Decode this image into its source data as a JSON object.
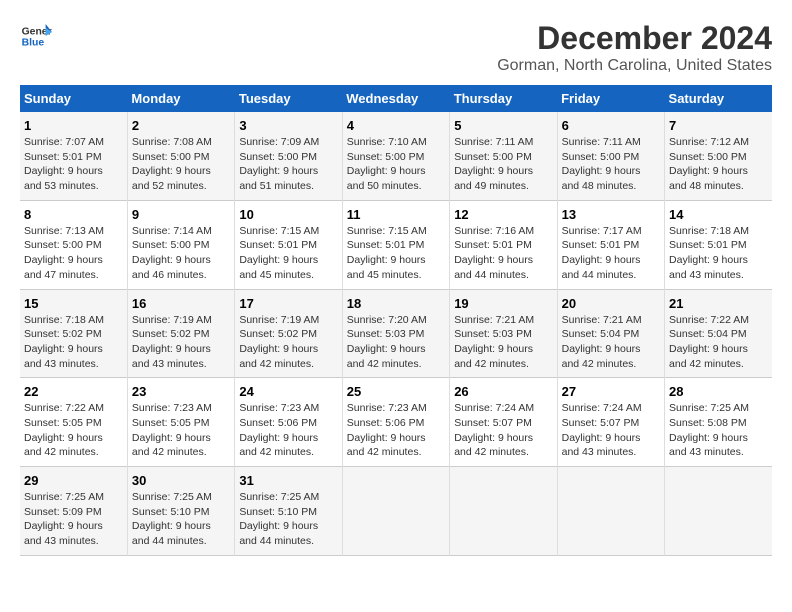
{
  "logo": {
    "line1": "General",
    "line2": "Blue"
  },
  "title": "December 2024",
  "subtitle": "Gorman, North Carolina, United States",
  "header_color": "#1565c0",
  "columns": [
    "Sunday",
    "Monday",
    "Tuesday",
    "Wednesday",
    "Thursday",
    "Friday",
    "Saturday"
  ],
  "weeks": [
    [
      {
        "day": "1",
        "info": "Sunrise: 7:07 AM\nSunset: 5:01 PM\nDaylight: 9 hours\nand 53 minutes."
      },
      {
        "day": "2",
        "info": "Sunrise: 7:08 AM\nSunset: 5:00 PM\nDaylight: 9 hours\nand 52 minutes."
      },
      {
        "day": "3",
        "info": "Sunrise: 7:09 AM\nSunset: 5:00 PM\nDaylight: 9 hours\nand 51 minutes."
      },
      {
        "day": "4",
        "info": "Sunrise: 7:10 AM\nSunset: 5:00 PM\nDaylight: 9 hours\nand 50 minutes."
      },
      {
        "day": "5",
        "info": "Sunrise: 7:11 AM\nSunset: 5:00 PM\nDaylight: 9 hours\nand 49 minutes."
      },
      {
        "day": "6",
        "info": "Sunrise: 7:11 AM\nSunset: 5:00 PM\nDaylight: 9 hours\nand 48 minutes."
      },
      {
        "day": "7",
        "info": "Sunrise: 7:12 AM\nSunset: 5:00 PM\nDaylight: 9 hours\nand 48 minutes."
      }
    ],
    [
      {
        "day": "8",
        "info": "Sunrise: 7:13 AM\nSunset: 5:00 PM\nDaylight: 9 hours\nand 47 minutes."
      },
      {
        "day": "9",
        "info": "Sunrise: 7:14 AM\nSunset: 5:00 PM\nDaylight: 9 hours\nand 46 minutes."
      },
      {
        "day": "10",
        "info": "Sunrise: 7:15 AM\nSunset: 5:01 PM\nDaylight: 9 hours\nand 45 minutes."
      },
      {
        "day": "11",
        "info": "Sunrise: 7:15 AM\nSunset: 5:01 PM\nDaylight: 9 hours\nand 45 minutes."
      },
      {
        "day": "12",
        "info": "Sunrise: 7:16 AM\nSunset: 5:01 PM\nDaylight: 9 hours\nand 44 minutes."
      },
      {
        "day": "13",
        "info": "Sunrise: 7:17 AM\nSunset: 5:01 PM\nDaylight: 9 hours\nand 44 minutes."
      },
      {
        "day": "14",
        "info": "Sunrise: 7:18 AM\nSunset: 5:01 PM\nDaylight: 9 hours\nand 43 minutes."
      }
    ],
    [
      {
        "day": "15",
        "info": "Sunrise: 7:18 AM\nSunset: 5:02 PM\nDaylight: 9 hours\nand 43 minutes."
      },
      {
        "day": "16",
        "info": "Sunrise: 7:19 AM\nSunset: 5:02 PM\nDaylight: 9 hours\nand 43 minutes."
      },
      {
        "day": "17",
        "info": "Sunrise: 7:19 AM\nSunset: 5:02 PM\nDaylight: 9 hours\nand 42 minutes."
      },
      {
        "day": "18",
        "info": "Sunrise: 7:20 AM\nSunset: 5:03 PM\nDaylight: 9 hours\nand 42 minutes."
      },
      {
        "day": "19",
        "info": "Sunrise: 7:21 AM\nSunset: 5:03 PM\nDaylight: 9 hours\nand 42 minutes."
      },
      {
        "day": "20",
        "info": "Sunrise: 7:21 AM\nSunset: 5:04 PM\nDaylight: 9 hours\nand 42 minutes."
      },
      {
        "day": "21",
        "info": "Sunrise: 7:22 AM\nSunset: 5:04 PM\nDaylight: 9 hours\nand 42 minutes."
      }
    ],
    [
      {
        "day": "22",
        "info": "Sunrise: 7:22 AM\nSunset: 5:05 PM\nDaylight: 9 hours\nand 42 minutes."
      },
      {
        "day": "23",
        "info": "Sunrise: 7:23 AM\nSunset: 5:05 PM\nDaylight: 9 hours\nand 42 minutes."
      },
      {
        "day": "24",
        "info": "Sunrise: 7:23 AM\nSunset: 5:06 PM\nDaylight: 9 hours\nand 42 minutes."
      },
      {
        "day": "25",
        "info": "Sunrise: 7:23 AM\nSunset: 5:06 PM\nDaylight: 9 hours\nand 42 minutes."
      },
      {
        "day": "26",
        "info": "Sunrise: 7:24 AM\nSunset: 5:07 PM\nDaylight: 9 hours\nand 42 minutes."
      },
      {
        "day": "27",
        "info": "Sunrise: 7:24 AM\nSunset: 5:07 PM\nDaylight: 9 hours\nand 43 minutes."
      },
      {
        "day": "28",
        "info": "Sunrise: 7:25 AM\nSunset: 5:08 PM\nDaylight: 9 hours\nand 43 minutes."
      }
    ],
    [
      {
        "day": "29",
        "info": "Sunrise: 7:25 AM\nSunset: 5:09 PM\nDaylight: 9 hours\nand 43 minutes."
      },
      {
        "day": "30",
        "info": "Sunrise: 7:25 AM\nSunset: 5:10 PM\nDaylight: 9 hours\nand 44 minutes."
      },
      {
        "day": "31",
        "info": "Sunrise: 7:25 AM\nSunset: 5:10 PM\nDaylight: 9 hours\nand 44 minutes."
      },
      {
        "day": "",
        "info": ""
      },
      {
        "day": "",
        "info": ""
      },
      {
        "day": "",
        "info": ""
      },
      {
        "day": "",
        "info": ""
      }
    ]
  ]
}
